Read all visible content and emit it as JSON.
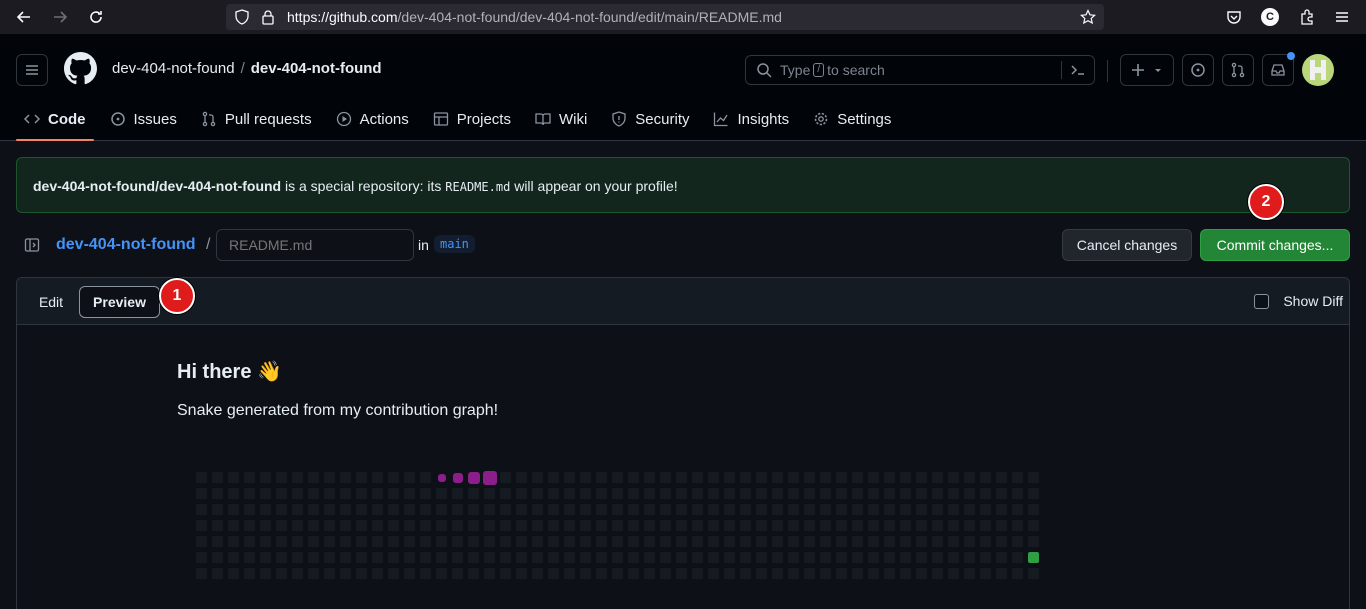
{
  "browser": {
    "url_host": "https://github.com",
    "url_path": "/dev-404-not-found/dev-404-not-found/edit/main/README.md",
    "profile_initial": "C"
  },
  "header": {
    "owner": "dev-404-not-found",
    "repo": "dev-404-not-found",
    "search_type": "Type",
    "search_key": "/",
    "search_rest": "to search"
  },
  "tabs": [
    {
      "label": "Code",
      "icon": "code-icon",
      "active": true
    },
    {
      "label": "Issues",
      "icon": "issue-icon"
    },
    {
      "label": "Pull requests",
      "icon": "pull-request-icon"
    },
    {
      "label": "Actions",
      "icon": "play-icon"
    },
    {
      "label": "Projects",
      "icon": "table-icon"
    },
    {
      "label": "Wiki",
      "icon": "book-icon"
    },
    {
      "label": "Security",
      "icon": "shield-icon"
    },
    {
      "label": "Insights",
      "icon": "graph-icon"
    },
    {
      "label": "Settings",
      "icon": "gear-icon"
    }
  ],
  "notice": {
    "repo_full": "dev-404-not-found/dev-404-not-found",
    "text_1": " is a special repository: its ",
    "file": "README.md",
    "text_2": " will appear on your profile!"
  },
  "editor": {
    "repo_link": "dev-404-not-found",
    "slash": "/",
    "filename_placeholder": "README.md",
    "in_label": "in",
    "branch": "main",
    "cancel_label": "Cancel changes",
    "commit_label": "Commit changes...",
    "edit_tab": "Edit",
    "preview_tab": "Preview",
    "show_diff_label": "Show Diff"
  },
  "preview": {
    "heading": "Hi there 👋",
    "paragraph": "Snake generated from my contribution graph!",
    "snake_color": "#8b1e8b",
    "food_color": "#2ea043",
    "empty_color": "#161b22"
  },
  "markers": [
    "1",
    "2"
  ]
}
